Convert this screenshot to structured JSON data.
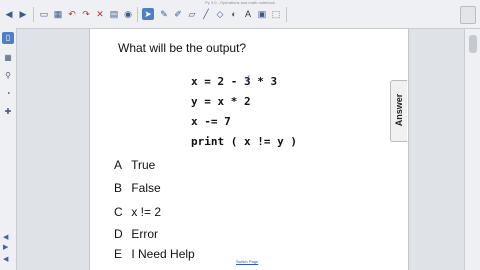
{
  "window": {
    "title": "Py 3.0 - Operations and math.notebook"
  },
  "toolbar": {
    "icons": [
      "previous-page-icon",
      "next-page-icon",
      "display-icon",
      "table-icon",
      "undo-icon",
      "redo-icon",
      "delete-icon",
      "screen-shade-icon",
      "document-camera-icon",
      "select-icon",
      "pen-icon",
      "creative-pen-icon",
      "eraser-icon",
      "line-icon",
      "shape-icon",
      "fill-icon",
      "text-icon",
      "properties-icon",
      "screen-capture-icon"
    ]
  },
  "question": {
    "text": "What will be the output?"
  },
  "code": {
    "lines": [
      "x = 2 - 3 * 3",
      "y = x * 2",
      "x -= 7",
      "print ( x != y )"
    ]
  },
  "options": [
    {
      "letter": "A",
      "text": "True"
    },
    {
      "letter": "B",
      "text": "False"
    },
    {
      "letter": "C",
      "text": "x != 2"
    },
    {
      "letter": "D",
      "text": "Error"
    },
    {
      "letter": "E",
      "text": "I Need Help"
    }
  ],
  "answer_tab": {
    "label": "Answer"
  },
  "footer": {
    "link_text": "Switch Page"
  }
}
